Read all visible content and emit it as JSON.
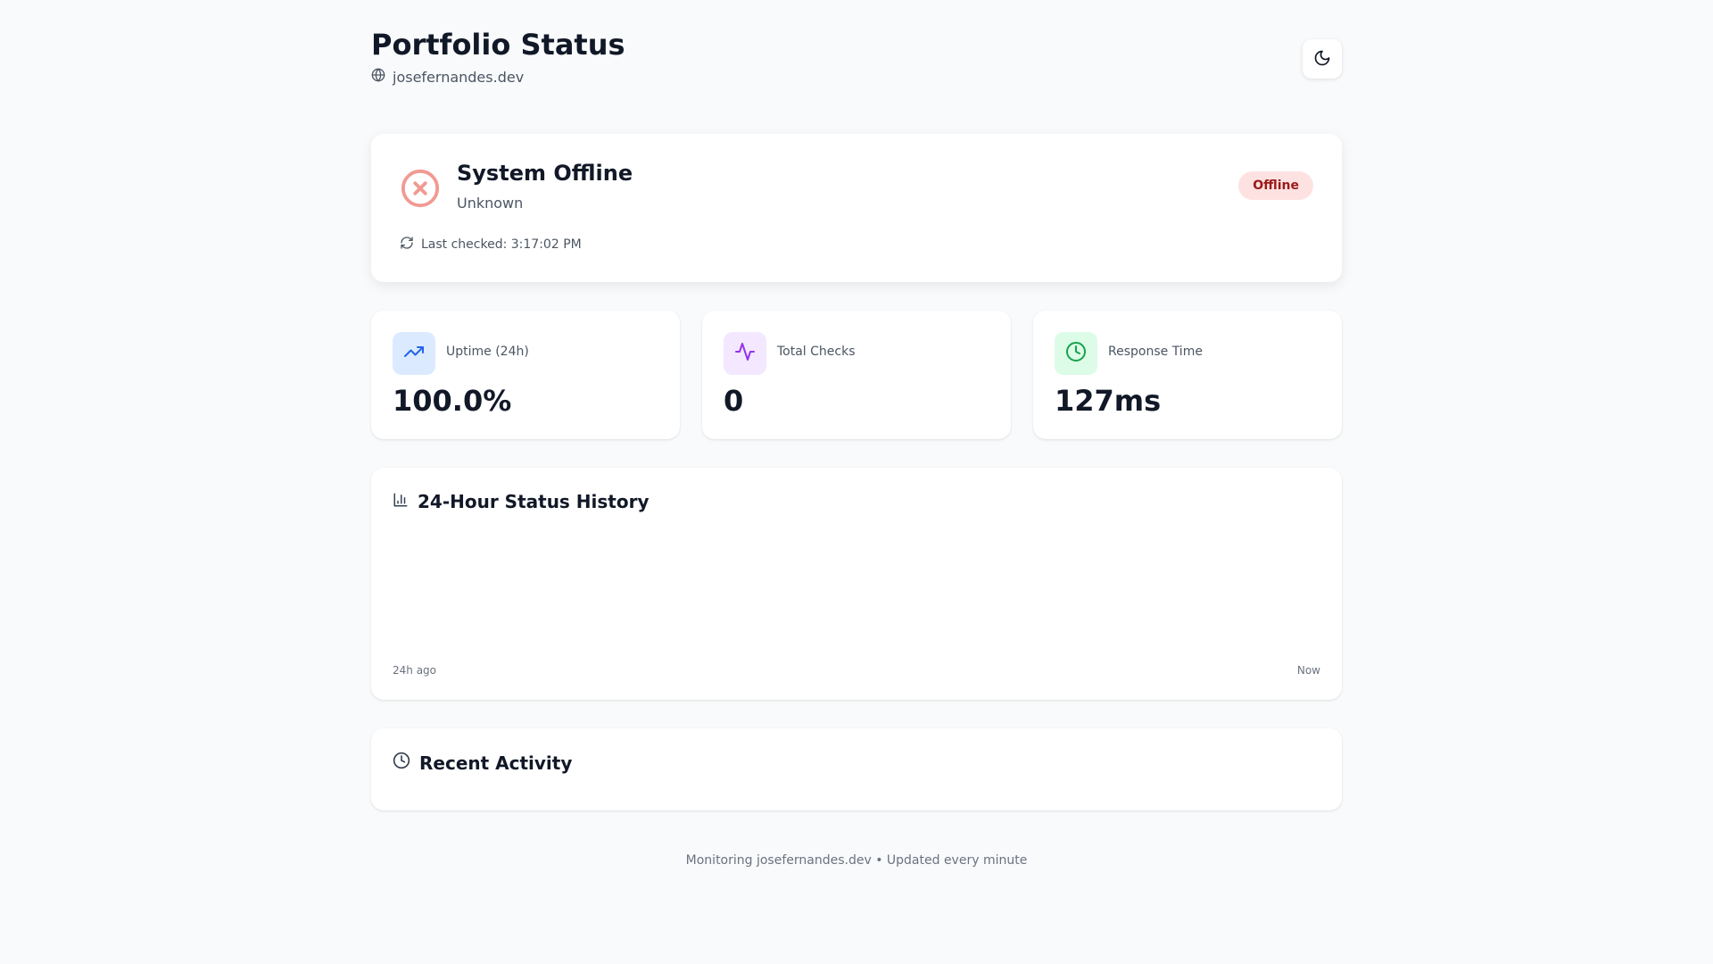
{
  "header": {
    "title": "Portfolio Status",
    "domain": "josefernandes.dev"
  },
  "status": {
    "title": "System Offline",
    "subtitle": "Unknown",
    "badge": "Offline",
    "last_checked": "Last checked: 3:17:02 PM"
  },
  "stats": [
    {
      "label": "Uptime (24h)",
      "value": "100.0%"
    },
    {
      "label": "Total Checks",
      "value": "0"
    },
    {
      "label": "Response Time",
      "value": "127ms"
    }
  ],
  "history": {
    "title": "24-Hour Status History",
    "start_label": "24h ago",
    "end_label": "Now"
  },
  "activity": {
    "title": "Recent Activity"
  },
  "footer": {
    "text": "Monitoring josefernandes.dev • Updated every minute"
  },
  "colors": {
    "offline_badge_bg": "#fee2e2",
    "offline_badge_text": "#991b1b",
    "offline_icon": "#f19a93",
    "uptime_icon_bg": "#dbeafe",
    "uptime_icon": "#2563eb",
    "checks_icon_bg": "#f3e8ff",
    "checks_icon": "#9333ea",
    "response_icon_bg": "#dcfce7",
    "response_icon": "#16a34a"
  }
}
